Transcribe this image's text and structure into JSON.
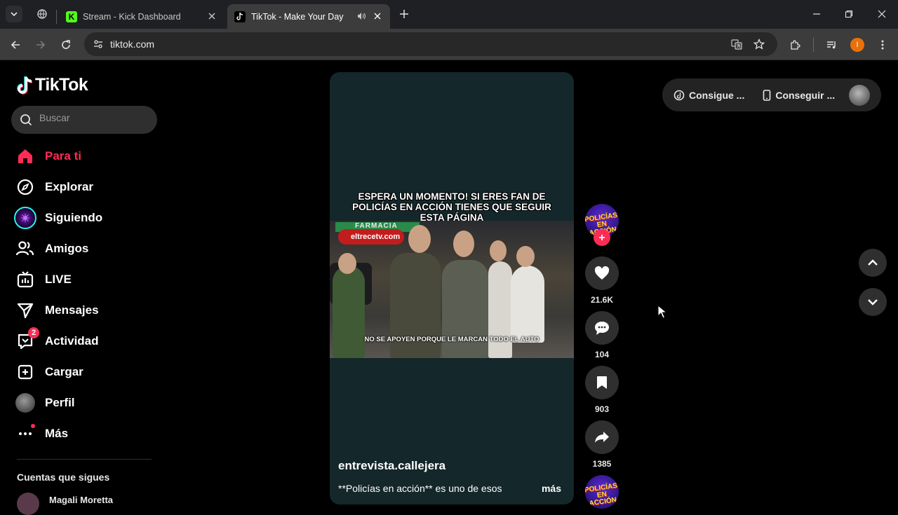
{
  "browser": {
    "tabs": [
      {
        "title": "Stream - Kick Dashboard",
        "icon": "kick-icon",
        "active": false
      },
      {
        "title": "TikTok - Make Your Day",
        "icon": "tiktok-icon",
        "active": true,
        "audio": true
      }
    ],
    "url": "tiktok.com",
    "profile_initial": "I"
  },
  "tiktok": {
    "logo_text": "TikTok",
    "search_placeholder": "Buscar",
    "nav": [
      {
        "label": "Para ti",
        "icon": "home-icon",
        "active": true
      },
      {
        "label": "Explorar",
        "icon": "compass-icon"
      },
      {
        "label": "Siguiendo",
        "icon": "following-avatar-icon"
      },
      {
        "label": "Amigos",
        "icon": "friends-icon"
      },
      {
        "label": "LIVE",
        "icon": "live-icon"
      },
      {
        "label": "Mensajes",
        "icon": "messages-icon"
      },
      {
        "label": "Actividad",
        "icon": "activity-icon",
        "badge": "2"
      },
      {
        "label": "Cargar",
        "icon": "upload-icon"
      },
      {
        "label": "Perfil",
        "icon": "profile-avatar-icon"
      },
      {
        "label": "Más",
        "icon": "more-icon"
      }
    ],
    "following_title": "Cuentas que sigues",
    "following_users": [
      "Magali Moretta"
    ]
  },
  "video": {
    "banner": "ESPERA UN MOMENTO! SI ERES FAN DE POLICÍAS EN ACCIÓN TIENES QUE SEGUIR ESTA PÁGINA",
    "sign_text": "FARMACIA",
    "brand_text": "eltrecetv.com",
    "subtitle": "NO SE APOYEN PORQUE LE MARCAN TODO EL AUTO",
    "author": "entrevista.callejera",
    "description": "**Policías en acción** es uno de esos",
    "more": "más",
    "creator_avatar_text": "POLICÍAS EN ACCIÓN"
  },
  "actions": {
    "likes": "21.6K",
    "comments": "104",
    "saves": "903",
    "shares": "1385"
  },
  "right_panel": {
    "get_coins": "Consigue ...",
    "get_app": "Conseguir ..."
  },
  "colors": {
    "accent": "#fe2c55",
    "video_bg": "#14272b",
    "chrome_bg": "#1f2023",
    "toolbar_bg": "#3c3c3c"
  }
}
